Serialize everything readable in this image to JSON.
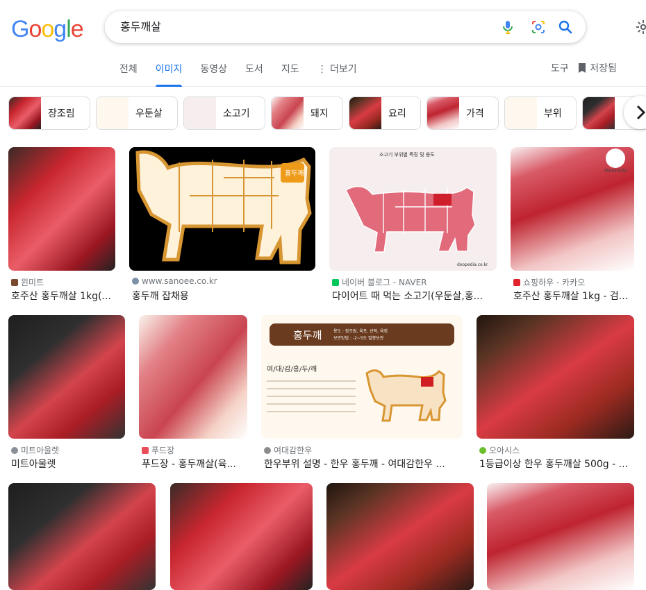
{
  "search": {
    "query": "홍두깨살"
  },
  "logo": "Google",
  "tabs": [
    {
      "label": "전체"
    },
    {
      "label": "이미지"
    },
    {
      "label": "동영상"
    },
    {
      "label": "도서"
    },
    {
      "label": "지도"
    },
    {
      "label": "더보기"
    }
  ],
  "tools": {
    "tool_label": "도구",
    "saved_label": "저장됨"
  },
  "chips": [
    {
      "label": "장조림"
    },
    {
      "label": "우둔살"
    },
    {
      "label": "소고기"
    },
    {
      "label": "돼지"
    },
    {
      "label": "요리"
    },
    {
      "label": "가격"
    },
    {
      "label": "부위"
    }
  ],
  "results": [
    {
      "source": "윈미트",
      "title": "호주산 홍두깨살 1kg(..."
    },
    {
      "source": "www.sanoee.co.kr",
      "title": "홍두깨 잡채용"
    },
    {
      "source": "네이버 블로그 - NAVER",
      "title": "다이어트 때 먹는 소고기(우둔살,홍..."
    },
    {
      "source": "쇼핑하우 - 카카오",
      "title": "호주산 홍두깨살 1kg - 검..."
    },
    {
      "source": "미트아울렛",
      "title": "미트아울렛"
    },
    {
      "source": "푸드장",
      "title": "푸드장 - 홍두깨살(육..."
    },
    {
      "source": "여대감한우",
      "title": "한우부위 설명 - 한우 홍두깨 - 여대감한우 ..."
    },
    {
      "source": "오아시스",
      "title": "1등급이상 한우 홍두깨살 500g - ..."
    }
  ],
  "image_text": {
    "cow_label": "홍두깨",
    "chart_title": "소고기 부위별 특징 및 용도",
    "poster_title": "홍두깨",
    "poster_subtitle": "용도 : 장조림, 육포, 산적, 육회",
    "poster_storage": "보관방법 : -2~5도 밀봉보관",
    "poster_heading": "여/대/감/홍/두/깨",
    "brand": "Meatholic",
    "site": "doopedia.co.kr"
  }
}
